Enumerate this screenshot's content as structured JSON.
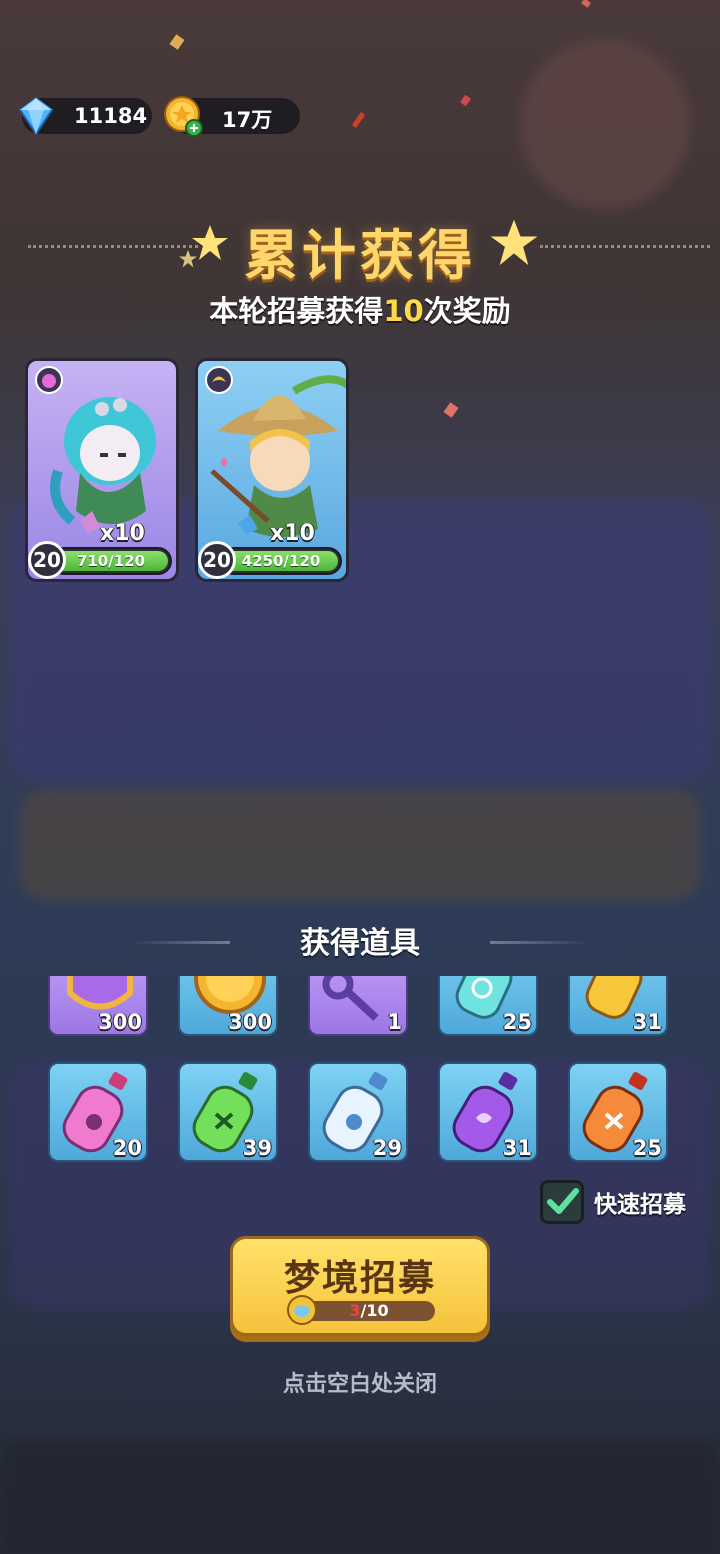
{
  "currencies": {
    "gems": "11184",
    "gold": "17万"
  },
  "reward_panel": {
    "title": "累计获得",
    "subtitle_prefix": "本轮招募获得",
    "subtitle_count": "10",
    "subtitle_suffix": "次奖励"
  },
  "heroes": [
    {
      "count": "x10",
      "level": "20",
      "progress": "710/120",
      "theme": "purple"
    },
    {
      "count": "x10",
      "level": "20",
      "progress": "4250/120",
      "theme": "blue"
    }
  ],
  "items_section": {
    "title": "获得道具",
    "row1": [
      {
        "icon": "purple-shield-icon",
        "count": "300"
      },
      {
        "icon": "gold-coin-icon",
        "count": "300"
      },
      {
        "icon": "key-icon",
        "count": "1"
      },
      {
        "icon": "cyan-bottle-icon",
        "count": "25"
      },
      {
        "icon": "yellow-bottle-icon",
        "count": "31"
      }
    ],
    "row2": [
      {
        "icon": "pink-bottle-icon",
        "count": "20"
      },
      {
        "icon": "green-bottle-icon",
        "count": "39"
      },
      {
        "icon": "white-bottle-icon",
        "count": "29"
      },
      {
        "icon": "purple-bottle-icon",
        "count": "31"
      },
      {
        "icon": "orange-bottle-icon",
        "count": "25"
      }
    ]
  },
  "quick_recruit": {
    "label": "快速招募",
    "checked": true
  },
  "recruit_button": {
    "label": "梦境招募",
    "progress_current": "3",
    "progress_total": "/10"
  },
  "close_hint": "点击空白处关闭",
  "colors": {
    "title": "#ffd66b",
    "highlight": "#ffd84a",
    "button": "#f6c23a",
    "progress_green": "#4db53a"
  }
}
